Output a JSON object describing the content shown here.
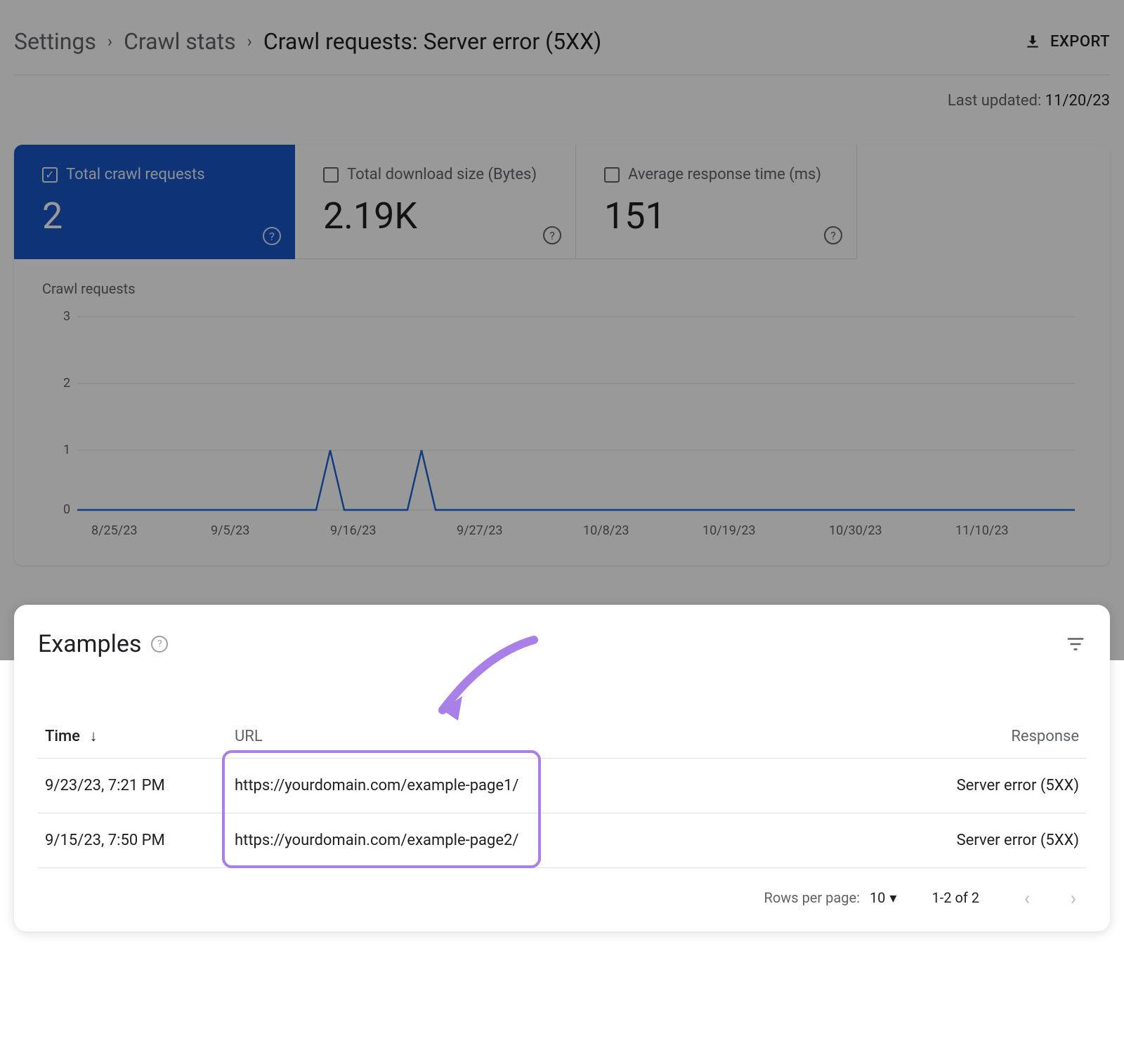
{
  "breadcrumb": {
    "items": [
      "Settings",
      "Crawl stats",
      "Crawl requests: Server error (5XX)"
    ]
  },
  "export_label": "EXPORT",
  "last_updated": {
    "prefix": "Last updated: ",
    "date": "11/20/23"
  },
  "metrics": [
    {
      "label": "Total crawl requests",
      "value": "2",
      "active": true
    },
    {
      "label": "Total download size (Bytes)",
      "value": "2.19K",
      "active": false
    },
    {
      "label": "Average response time (ms)",
      "value": "151",
      "active": false
    }
  ],
  "chart_data": {
    "type": "line",
    "title": "Crawl requests",
    "xlabel": "",
    "ylabel": "",
    "ylim": [
      0,
      3
    ],
    "y_ticks": [
      0,
      1,
      2,
      3
    ],
    "x_ticks": [
      "8/25/23",
      "9/5/23",
      "9/16/23",
      "9/27/23",
      "10/8/23",
      "10/19/23",
      "10/30/23",
      "11/10/23"
    ],
    "series": [
      {
        "name": "Crawl requests",
        "x": [
          "8/25/23",
          "9/5/23",
          "9/14/23",
          "9/15/23",
          "9/16/23",
          "9/22/23",
          "9/23/23",
          "9/24/23",
          "9/27/23",
          "10/8/23",
          "10/19/23",
          "10/30/23",
          "11/10/23",
          "11/20/23"
        ],
        "values": [
          0,
          0,
          0,
          1,
          0,
          0,
          1,
          0,
          0,
          0,
          0,
          0,
          0,
          0
        ]
      }
    ]
  },
  "examples": {
    "title": "Examples",
    "columns": {
      "time": "Time",
      "url": "URL",
      "response": "Response"
    },
    "rows": [
      {
        "time": "9/23/23, 7:21 PM",
        "url": "https://yourdomain.com/example-page1/",
        "response": "Server error (5XX)"
      },
      {
        "time": "9/15/23, 7:50 PM",
        "url": "https://yourdomain.com/example-page2/",
        "response": "Server error (5XX)"
      }
    ],
    "pager": {
      "rows_per_page_label": "Rows per page:",
      "rows_per_page_value": "10",
      "range": "1-2 of 2"
    }
  }
}
